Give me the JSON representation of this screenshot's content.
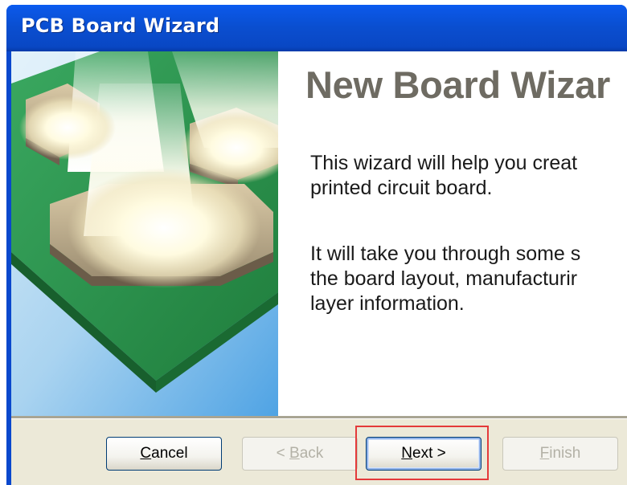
{
  "window": {
    "title": "PCB Board Wizard"
  },
  "page": {
    "heading": "New Board Wizar",
    "paragraph1": "This wizard will help you creat\nprinted circuit board.",
    "paragraph2": "It will take you through some s\nthe board layout, manufacturir\nlayer information."
  },
  "buttons": {
    "cancel": {
      "mnemonic": "C",
      "rest": "ancel"
    },
    "back": {
      "prefix": "< ",
      "mnemonic": "B",
      "rest": "ack"
    },
    "next": {
      "mnemonic": "N",
      "rest": "ext >"
    },
    "finish": {
      "mnemonic": "F",
      "rest": "inish"
    }
  },
  "colors": {
    "titlebar": "#0a4ecf",
    "heading": "#6e6b62",
    "board_green": "#2e9a52",
    "highlight": "#e43a3a"
  }
}
